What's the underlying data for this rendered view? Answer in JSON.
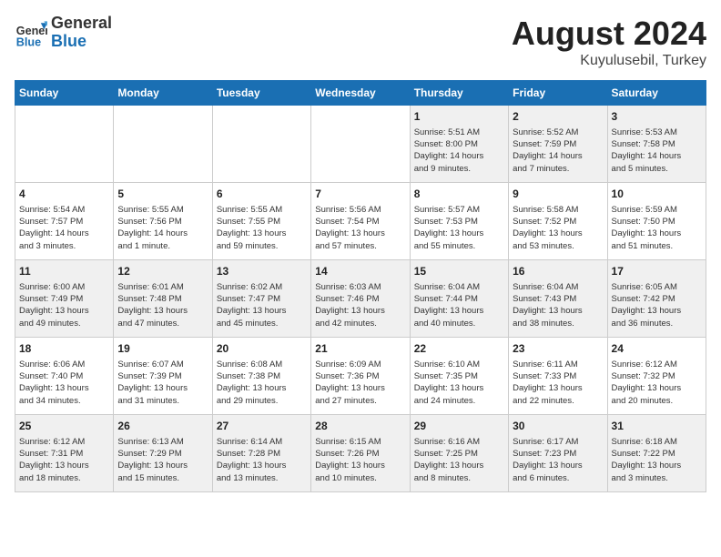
{
  "header": {
    "logo_general": "General",
    "logo_blue": "Blue",
    "month_year": "August 2024",
    "location": "Kuyulusebil, Turkey"
  },
  "days_of_week": [
    "Sunday",
    "Monday",
    "Tuesday",
    "Wednesday",
    "Thursday",
    "Friday",
    "Saturday"
  ],
  "weeks": [
    [
      {
        "day": "",
        "info": ""
      },
      {
        "day": "",
        "info": ""
      },
      {
        "day": "",
        "info": ""
      },
      {
        "day": "",
        "info": ""
      },
      {
        "day": "1",
        "info": "Sunrise: 5:51 AM\nSunset: 8:00 PM\nDaylight: 14 hours\nand 9 minutes."
      },
      {
        "day": "2",
        "info": "Sunrise: 5:52 AM\nSunset: 7:59 PM\nDaylight: 14 hours\nand 7 minutes."
      },
      {
        "day": "3",
        "info": "Sunrise: 5:53 AM\nSunset: 7:58 PM\nDaylight: 14 hours\nand 5 minutes."
      }
    ],
    [
      {
        "day": "4",
        "info": "Sunrise: 5:54 AM\nSunset: 7:57 PM\nDaylight: 14 hours\nand 3 minutes."
      },
      {
        "day": "5",
        "info": "Sunrise: 5:55 AM\nSunset: 7:56 PM\nDaylight: 14 hours\nand 1 minute."
      },
      {
        "day": "6",
        "info": "Sunrise: 5:55 AM\nSunset: 7:55 PM\nDaylight: 13 hours\nand 59 minutes."
      },
      {
        "day": "7",
        "info": "Sunrise: 5:56 AM\nSunset: 7:54 PM\nDaylight: 13 hours\nand 57 minutes."
      },
      {
        "day": "8",
        "info": "Sunrise: 5:57 AM\nSunset: 7:53 PM\nDaylight: 13 hours\nand 55 minutes."
      },
      {
        "day": "9",
        "info": "Sunrise: 5:58 AM\nSunset: 7:52 PM\nDaylight: 13 hours\nand 53 minutes."
      },
      {
        "day": "10",
        "info": "Sunrise: 5:59 AM\nSunset: 7:50 PM\nDaylight: 13 hours\nand 51 minutes."
      }
    ],
    [
      {
        "day": "11",
        "info": "Sunrise: 6:00 AM\nSunset: 7:49 PM\nDaylight: 13 hours\nand 49 minutes."
      },
      {
        "day": "12",
        "info": "Sunrise: 6:01 AM\nSunset: 7:48 PM\nDaylight: 13 hours\nand 47 minutes."
      },
      {
        "day": "13",
        "info": "Sunrise: 6:02 AM\nSunset: 7:47 PM\nDaylight: 13 hours\nand 45 minutes."
      },
      {
        "day": "14",
        "info": "Sunrise: 6:03 AM\nSunset: 7:46 PM\nDaylight: 13 hours\nand 42 minutes."
      },
      {
        "day": "15",
        "info": "Sunrise: 6:04 AM\nSunset: 7:44 PM\nDaylight: 13 hours\nand 40 minutes."
      },
      {
        "day": "16",
        "info": "Sunrise: 6:04 AM\nSunset: 7:43 PM\nDaylight: 13 hours\nand 38 minutes."
      },
      {
        "day": "17",
        "info": "Sunrise: 6:05 AM\nSunset: 7:42 PM\nDaylight: 13 hours\nand 36 minutes."
      }
    ],
    [
      {
        "day": "18",
        "info": "Sunrise: 6:06 AM\nSunset: 7:40 PM\nDaylight: 13 hours\nand 34 minutes."
      },
      {
        "day": "19",
        "info": "Sunrise: 6:07 AM\nSunset: 7:39 PM\nDaylight: 13 hours\nand 31 minutes."
      },
      {
        "day": "20",
        "info": "Sunrise: 6:08 AM\nSunset: 7:38 PM\nDaylight: 13 hours\nand 29 minutes."
      },
      {
        "day": "21",
        "info": "Sunrise: 6:09 AM\nSunset: 7:36 PM\nDaylight: 13 hours\nand 27 minutes."
      },
      {
        "day": "22",
        "info": "Sunrise: 6:10 AM\nSunset: 7:35 PM\nDaylight: 13 hours\nand 24 minutes."
      },
      {
        "day": "23",
        "info": "Sunrise: 6:11 AM\nSunset: 7:33 PM\nDaylight: 13 hours\nand 22 minutes."
      },
      {
        "day": "24",
        "info": "Sunrise: 6:12 AM\nSunset: 7:32 PM\nDaylight: 13 hours\nand 20 minutes."
      }
    ],
    [
      {
        "day": "25",
        "info": "Sunrise: 6:12 AM\nSunset: 7:31 PM\nDaylight: 13 hours\nand 18 minutes."
      },
      {
        "day": "26",
        "info": "Sunrise: 6:13 AM\nSunset: 7:29 PM\nDaylight: 13 hours\nand 15 minutes."
      },
      {
        "day": "27",
        "info": "Sunrise: 6:14 AM\nSunset: 7:28 PM\nDaylight: 13 hours\nand 13 minutes."
      },
      {
        "day": "28",
        "info": "Sunrise: 6:15 AM\nSunset: 7:26 PM\nDaylight: 13 hours\nand 10 minutes."
      },
      {
        "day": "29",
        "info": "Sunrise: 6:16 AM\nSunset: 7:25 PM\nDaylight: 13 hours\nand 8 minutes."
      },
      {
        "day": "30",
        "info": "Sunrise: 6:17 AM\nSunset: 7:23 PM\nDaylight: 13 hours\nand 6 minutes."
      },
      {
        "day": "31",
        "info": "Sunrise: 6:18 AM\nSunset: 7:22 PM\nDaylight: 13 hours\nand 3 minutes."
      }
    ]
  ]
}
